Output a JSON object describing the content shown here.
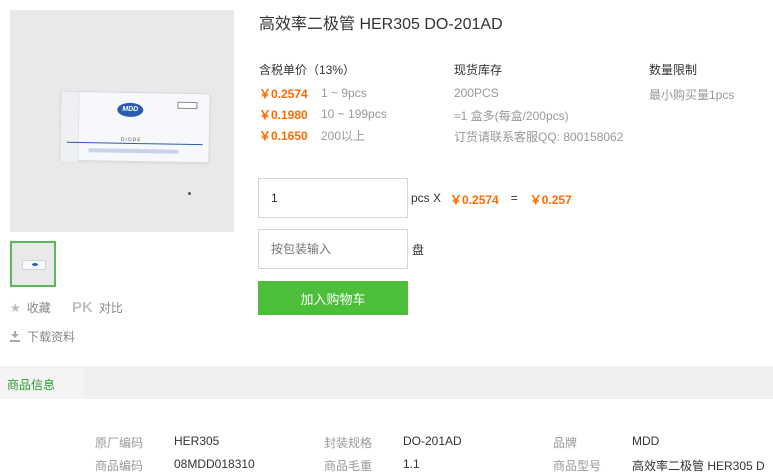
{
  "product": {
    "title": "高效率二极管 HER305 DO-201AD",
    "image": {
      "logo_text": "MDD",
      "label_text": "DIODE"
    }
  },
  "actions": {
    "favorite_label": "收藏",
    "compare_badge": "PK",
    "compare_label": "对比",
    "download_label": "下载资料"
  },
  "pricing": {
    "header": "含税单价（13%）",
    "tiers": [
      {
        "price": "￥0.2574",
        "qty": "1 ~ 9pcs"
      },
      {
        "price": "￥0.1980",
        "qty": "10 ~ 199pcs"
      },
      {
        "price": "￥0.1650",
        "qty": "200以上"
      }
    ]
  },
  "stock": {
    "header": "现货库存",
    "lines": [
      "200PCS",
      "≈1 盒多(每盒/200pcs)",
      "订货请联系客服QQ: 800158062"
    ]
  },
  "limit": {
    "header": "数量限制",
    "text": "最小购买量1pcs"
  },
  "order": {
    "quantity_value": "1",
    "unit_label": "pcs X",
    "unit_price": "￥0.2574",
    "equals": "=",
    "total": "￥0.257",
    "pack_placeholder": "按包装输入",
    "pack_unit": "盘",
    "add_to_cart": "加入购物车"
  },
  "tabs": {
    "active": "商品信息"
  },
  "specs": [
    {
      "label": "原厂编码",
      "value": "HER305"
    },
    {
      "label": "封装规格",
      "value": "DO-201AD"
    },
    {
      "label": "品牌",
      "value": "MDD"
    },
    {
      "label": "商品编码",
      "value": "08MDD018310"
    },
    {
      "label": "商品毛重",
      "value": "1.1"
    },
    {
      "label": "商品型号",
      "value": "高效率二极管 HER305 D"
    }
  ],
  "colors": {
    "price": "#ff6a00",
    "button": "#4cbe3a",
    "tab_text": "#2d9b2d"
  }
}
